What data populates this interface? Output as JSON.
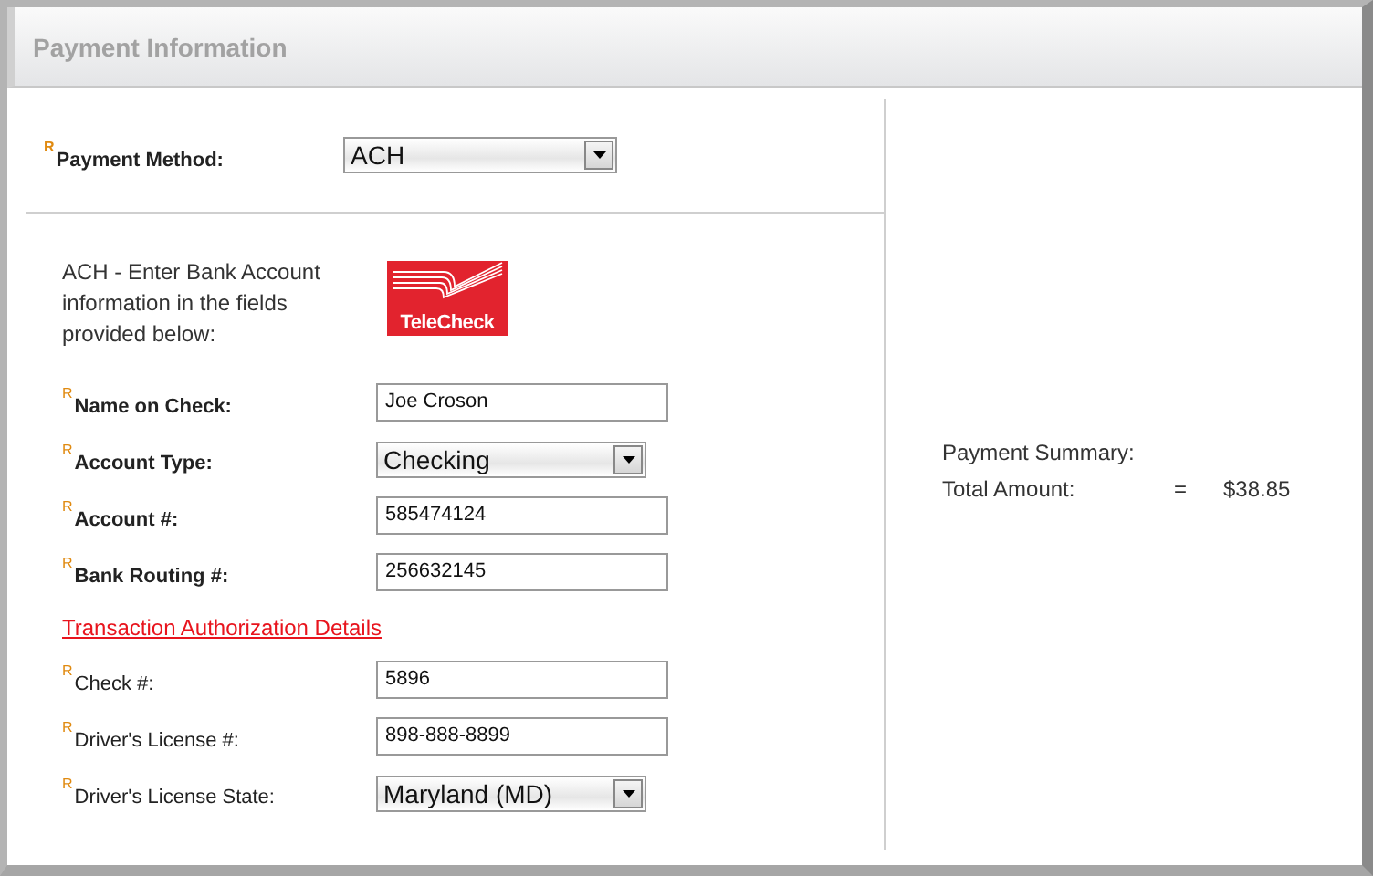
{
  "panel": {
    "title": "Payment Information"
  },
  "payment_method": {
    "mark": "R",
    "label": "Payment Method:",
    "value": "ACH"
  },
  "instructions": "ACH - Enter Bank Account information in the fields provided below:",
  "logo": {
    "text": "TeleCheck"
  },
  "account_fields": [
    {
      "mark": "R",
      "label": "Name on Check:",
      "kind": "text",
      "value": "Joe Croson"
    },
    {
      "mark": "R",
      "label": "Account Type:",
      "kind": "select",
      "value": "Checking"
    },
    {
      "mark": "R",
      "label": "Account #:",
      "kind": "text",
      "value": "585474124"
    },
    {
      "mark": "R",
      "label": "Bank Routing #:",
      "kind": "text",
      "value": "256632145"
    }
  ],
  "authorization_link": "Transaction Authorization Details",
  "authorization_fields": [
    {
      "mark": "R",
      "label": "Check #:",
      "kind": "text",
      "value": "5896"
    },
    {
      "mark": "R",
      "label": "Driver's License #:",
      "kind": "text",
      "value": "898-888-8899"
    },
    {
      "mark": "R",
      "label": "Driver's License State:",
      "kind": "select",
      "value": "Maryland (MD)"
    }
  ],
  "summary": {
    "title": "Payment Summary:",
    "label": "Total Amount:",
    "operator": "=",
    "amount": "$38.85"
  }
}
